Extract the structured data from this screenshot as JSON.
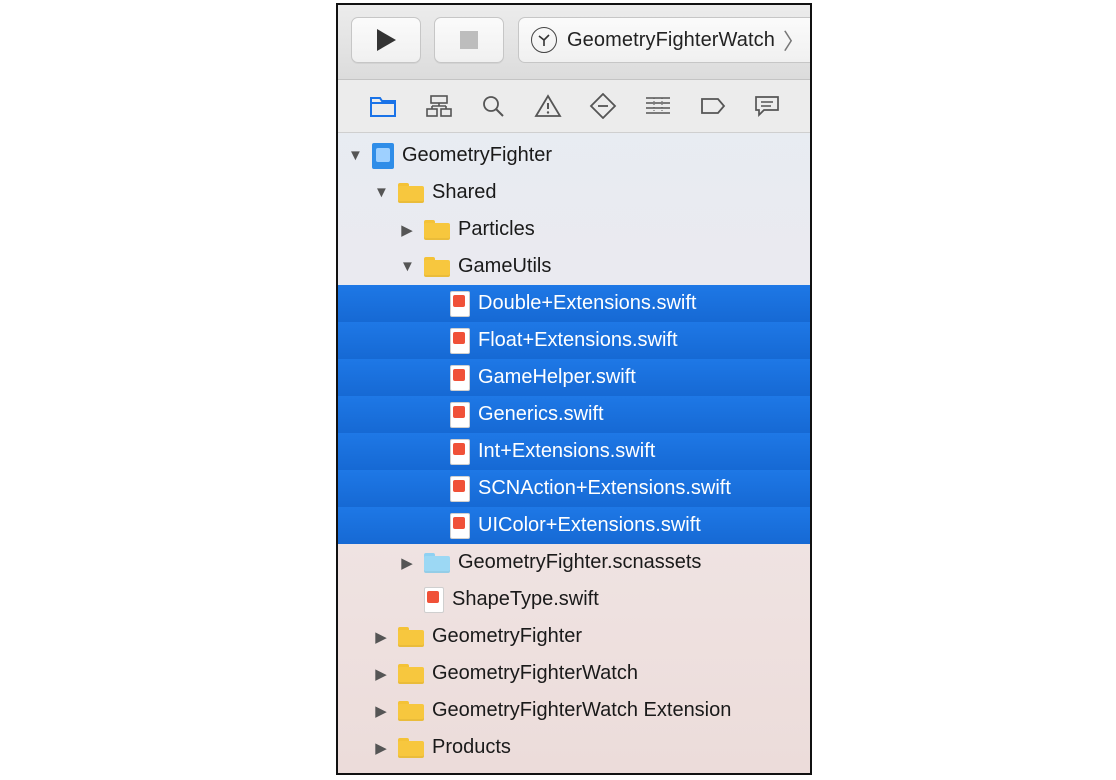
{
  "toolbar": {
    "scheme_name": "GeometryFighterWatch",
    "run_icon": "play-icon",
    "stop_icon": "stop-icon",
    "scheme_icon": "watch-icon",
    "scheme_chevron": "chevron-right-icon"
  },
  "navigator_tabs": [
    {
      "name": "project-navigator",
      "icon": "folder-icon",
      "active": true
    },
    {
      "name": "symbol-navigator",
      "icon": "hierarchy-icon"
    },
    {
      "name": "find-navigator",
      "icon": "search-icon"
    },
    {
      "name": "issue-navigator",
      "icon": "warning-icon"
    },
    {
      "name": "test-navigator",
      "icon": "diamond-minus-icon"
    },
    {
      "name": "debug-navigator",
      "icon": "list-icon"
    },
    {
      "name": "breakpoint-navigator",
      "icon": "breakpoint-icon"
    },
    {
      "name": "report-navigator",
      "icon": "speech-bubble-icon"
    }
  ],
  "tree": [
    {
      "label": "GeometryFighter",
      "type": "project",
      "depth": 0,
      "expanded": true
    },
    {
      "label": "Shared",
      "type": "folder",
      "depth": 1,
      "expanded": true
    },
    {
      "label": "Particles",
      "type": "folder",
      "depth": 2,
      "expanded": false
    },
    {
      "label": "GameUtils",
      "type": "folder",
      "depth": 2,
      "expanded": true
    },
    {
      "label": "Double+Extensions.swift",
      "type": "swift",
      "depth": 3,
      "selected": true
    },
    {
      "label": "Float+Extensions.swift",
      "type": "swift",
      "depth": 3,
      "selected": true
    },
    {
      "label": "GameHelper.swift",
      "type": "swift",
      "depth": 3,
      "selected": true
    },
    {
      "label": "Generics.swift",
      "type": "swift",
      "depth": 3,
      "selected": true
    },
    {
      "label": "Int+Extensions.swift",
      "type": "swift",
      "depth": 3,
      "selected": true
    },
    {
      "label": "SCNAction+Extensions.swift",
      "type": "swift",
      "depth": 3,
      "selected": true
    },
    {
      "label": "UIColor+Extensions.swift",
      "type": "swift",
      "depth": 3,
      "selected": true
    },
    {
      "label": "GeometryFighter.scnassets",
      "type": "folder-blue",
      "depth": 2,
      "expanded": false
    },
    {
      "label": "ShapeType.swift",
      "type": "swift",
      "depth": 2
    },
    {
      "label": "GeometryFighter",
      "type": "folder",
      "depth": 1,
      "expanded": false
    },
    {
      "label": "GeometryFighterWatch",
      "type": "folder",
      "depth": 1,
      "expanded": false
    },
    {
      "label": "GeometryFighterWatch Extension",
      "type": "folder",
      "depth": 1,
      "expanded": false
    },
    {
      "label": "Products",
      "type": "folder",
      "depth": 1,
      "expanded": false
    }
  ],
  "colors": {
    "selection": "#1a6fdc",
    "folder": "#f7c73e",
    "accent": "#2f8de8"
  }
}
